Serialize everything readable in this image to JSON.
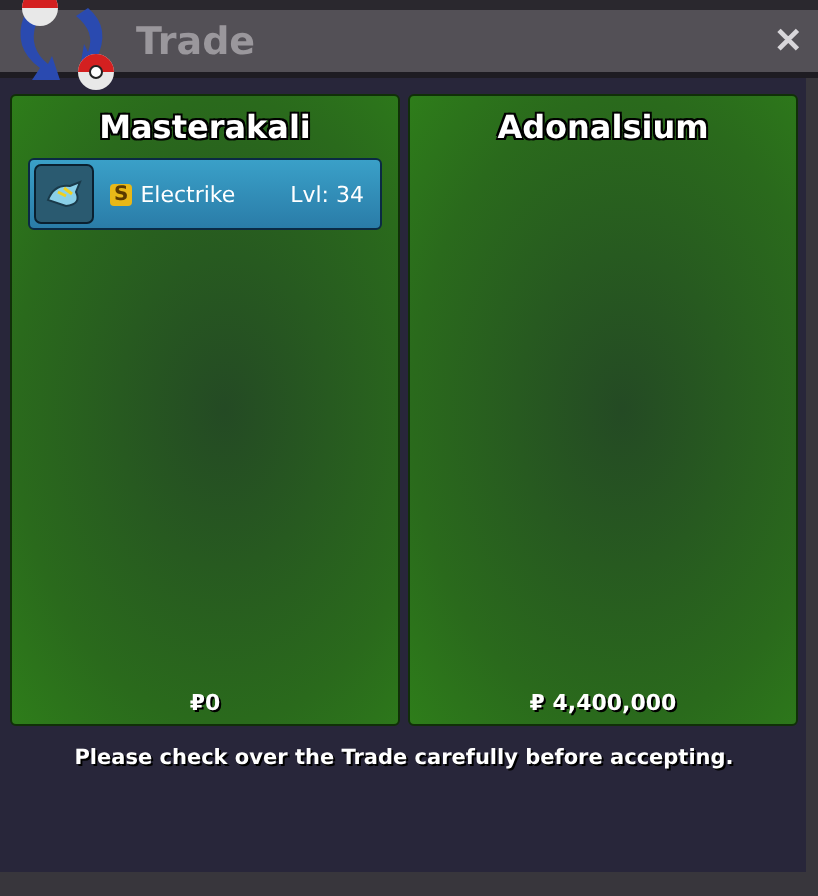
{
  "window": {
    "title": "Trade",
    "close": "✕"
  },
  "panels": [
    {
      "owner": "Masterakali",
      "items": [
        {
          "badge": "S",
          "name": "Electrike",
          "level": "Lvl: 34"
        }
      ],
      "money": "₽0"
    },
    {
      "owner": "Adonalsium",
      "money": "₽ 4,400,000"
    }
  ],
  "footer": "Please check over the Trade carefully before accepting."
}
